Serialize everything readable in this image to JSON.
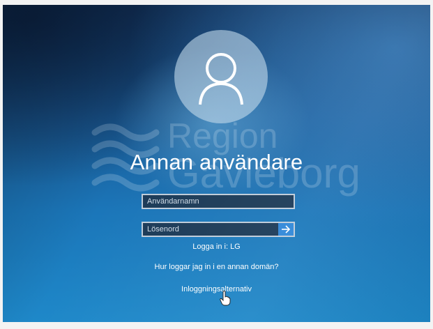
{
  "login": {
    "user_name": "Annan användare",
    "username_placeholder": "Användarnamn",
    "password_placeholder": "Lösenord",
    "sign_in_to": "Logga in i: LG",
    "other_domain_link": "Hur loggar jag in i en annan domän?",
    "sign_in_options": "Inloggningsalternativ"
  },
  "watermark": {
    "line1": "Region",
    "line2": "Gävleborg"
  },
  "icons": {
    "avatar": "user-icon",
    "submit": "arrow-right-icon",
    "cursor": "hand-pointer-icon",
    "logo": "waves-logo"
  },
  "colors": {
    "background_dark": "#12335c",
    "background_light": "#1e88c9",
    "submit_button": "#2f87d8",
    "field_background": "#1b3a57"
  }
}
